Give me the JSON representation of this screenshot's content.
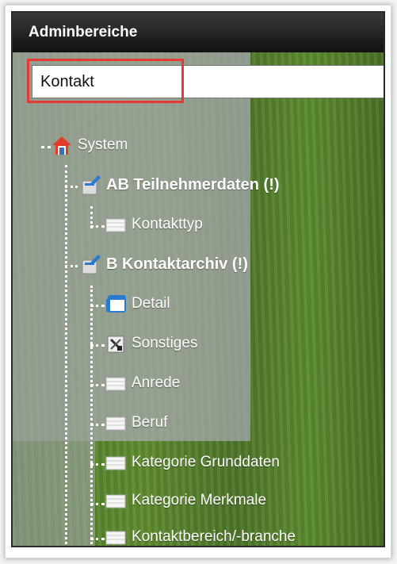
{
  "header": {
    "title": "Adminbereiche"
  },
  "search": {
    "value": "Kontakt"
  },
  "tree": {
    "root": {
      "label": "System",
      "icon": "home-icon"
    },
    "items": [
      {
        "label": "AB Teilnehmerdaten (!)",
        "icon": "folder-pen-icon",
        "bold": true
      },
      {
        "label": "Kontakttyp",
        "icon": "table-icon"
      },
      {
        "label": "B Kontaktarchiv (!)",
        "icon": "folder-pen-icon",
        "bold": true
      },
      {
        "label": "Detail",
        "icon": "window-icon"
      },
      {
        "label": "Sonstiges",
        "icon": "tools-icon"
      },
      {
        "label": "Anrede",
        "icon": "table-icon"
      },
      {
        "label": "Beruf",
        "icon": "table-icon"
      },
      {
        "label": "Kategorie Grunddaten",
        "icon": "table-icon"
      },
      {
        "label": "Kategorie Merkmale",
        "icon": "table-icon"
      },
      {
        "label": "Kontaktbereich/-branche",
        "icon": "table-icon"
      }
    ]
  },
  "colors": {
    "highlight": "#e53935",
    "header": "#111111",
    "background": "#5a8a2e"
  }
}
